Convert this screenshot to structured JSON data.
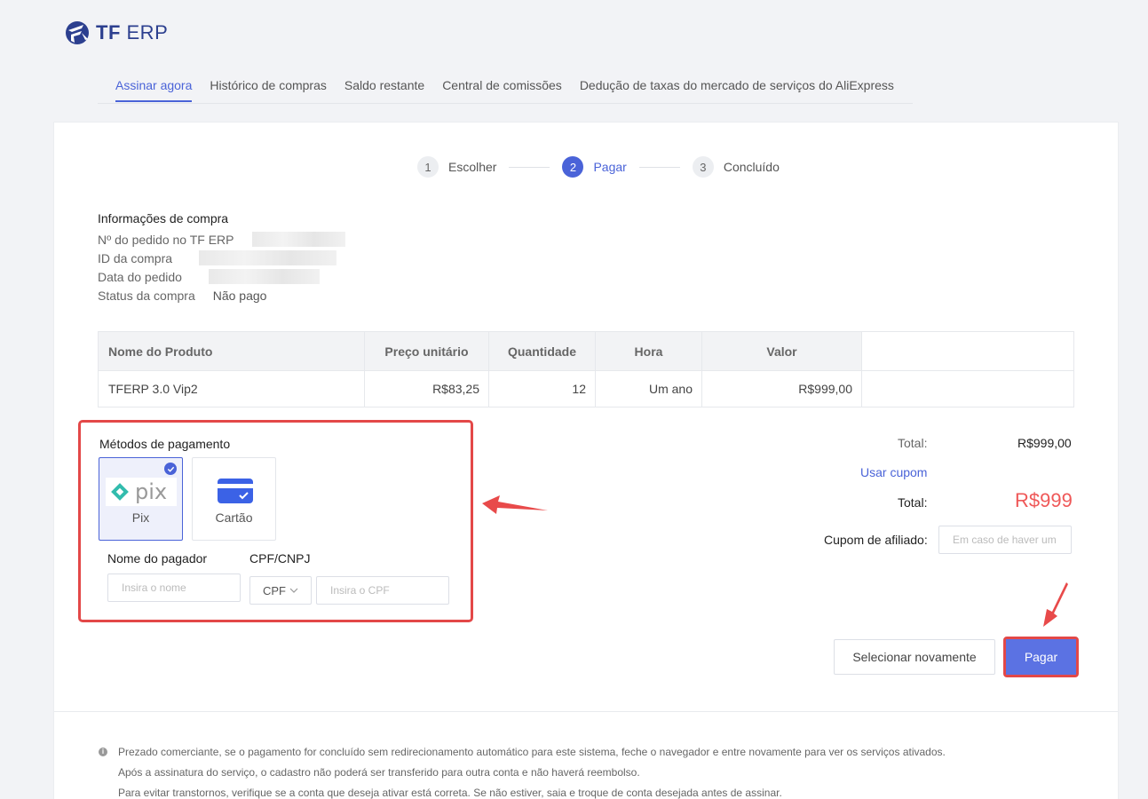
{
  "brand": {
    "name_bold": "TF",
    "name_rest": " ERP",
    "color": "#2c3f8f"
  },
  "tabs": [
    {
      "label": "Assinar agora",
      "active": true
    },
    {
      "label": "Histórico de compras"
    },
    {
      "label": "Saldo restante"
    },
    {
      "label": "Central de comissões"
    },
    {
      "label": "Dedução de taxas do mercado de serviços do AliExpress"
    }
  ],
  "steps": [
    {
      "num": "1",
      "label": "Escolher"
    },
    {
      "num": "2",
      "label": "Pagar",
      "active": true
    },
    {
      "num": "3",
      "label": "Concluído"
    }
  ],
  "purchase_info": {
    "title": "Informações de compra",
    "order_no_label": "Nº do pedido no TF ERP",
    "purchase_id_label": "ID da compra",
    "order_date_label": "Data do pedido",
    "status_label": "Status da compra",
    "status_value": "Não pago"
  },
  "table": {
    "headers": [
      "Nome do Produto",
      "Preço unitário",
      "Quantidade",
      "Hora",
      "Valor"
    ],
    "rows": [
      [
        "TFERP 3.0 Vip2",
        "R$83,25",
        "12",
        "Um ano",
        "R$999,00"
      ]
    ]
  },
  "payment": {
    "title": "Métodos de pagamento",
    "methods": [
      {
        "label": "Pix",
        "logo_text": "pix",
        "icon": "pix-icon",
        "selected": true
      },
      {
        "label": "Cartão",
        "icon": "credit-card-icon"
      }
    ],
    "payer_name_label": "Nome do pagador",
    "payer_name_placeholder": "Insira o nome",
    "doc_label": "CPF/CNPJ",
    "doc_type": "CPF",
    "doc_placeholder": "Insira o CPF"
  },
  "summary": {
    "subtotal_label": "Total:",
    "subtotal_value": "R$999,00",
    "coupon_link": "Usar cupom",
    "total_label": "Total:",
    "total_value": "R$999",
    "affiliate_label": "Cupom de afiliado:",
    "affiliate_placeholder": "Em caso de haver um"
  },
  "buttons": {
    "reselect": "Selecionar novamente",
    "pay": "Pagar"
  },
  "notices": [
    "Prezado comerciante, se o pagamento for concluído sem redirecionamento automático para este sistema, feche o navegador e entre novamente para ver os serviços ativados.",
    "Após a assinatura do serviço, o cadastro não poderá ser transferido para outra conta e não haverá reembolso.",
    "Para evitar transtornos, verifique se a conta que deseja ativar está correta. Se não estiver, saia e troque de conta desejada antes de assinar."
  ],
  "colors": {
    "accent": "#4a63d8",
    "highlight": "#e34848",
    "price": "#ef5858"
  }
}
